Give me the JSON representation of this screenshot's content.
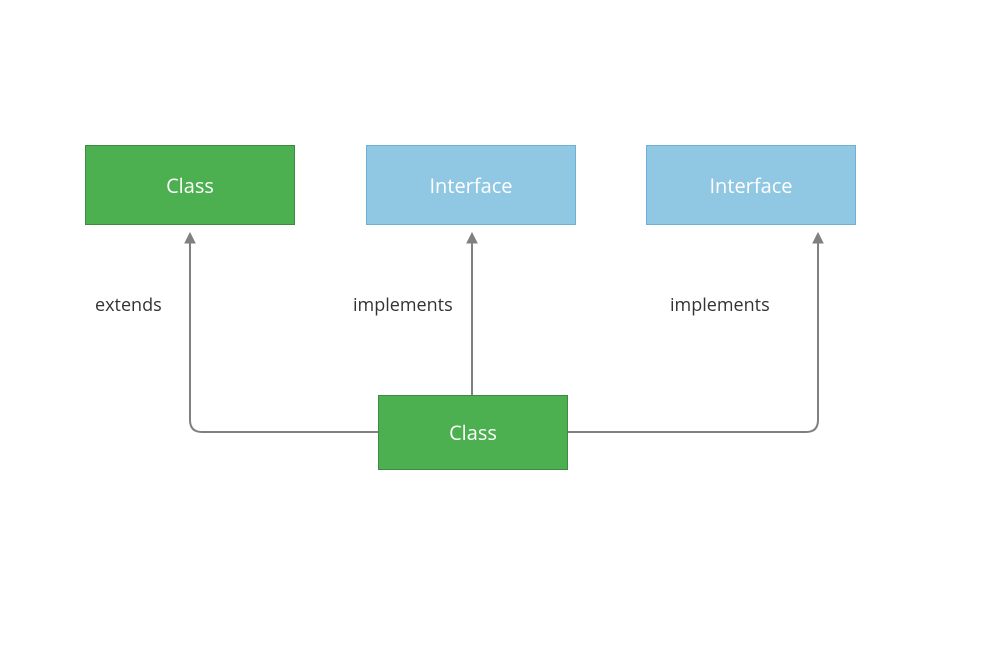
{
  "nodes": {
    "top_left": {
      "label": "Class",
      "color": "green"
    },
    "top_mid": {
      "label": "Interface",
      "color": "blue"
    },
    "top_right": {
      "label": "Interface",
      "color": "blue"
    },
    "bottom": {
      "label": "Class",
      "color": "green"
    }
  },
  "edges": {
    "left": {
      "label": "extends"
    },
    "mid": {
      "label": "implements"
    },
    "right": {
      "label": "implements"
    }
  },
  "colors": {
    "green": "#4caf50",
    "blue": "#90c7e3",
    "arrow": "#808080",
    "text": "#333333"
  }
}
